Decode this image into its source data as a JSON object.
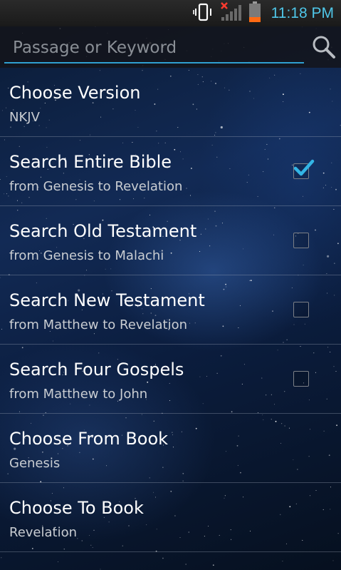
{
  "status_bar": {
    "time": "11:18 PM"
  },
  "search": {
    "placeholder": "Passage or Keyword",
    "value": ""
  },
  "items": [
    {
      "title": "Choose Version",
      "subtitle": "NKJV"
    },
    {
      "title": "Search Entire Bible",
      "subtitle": "from Genesis to Revelation",
      "checked": true
    },
    {
      "title": "Search Old Testament",
      "subtitle": "from Genesis to Malachi",
      "checked": false
    },
    {
      "title": "Search New Testament",
      "subtitle": "from Matthew to Revelation",
      "checked": false
    },
    {
      "title": "Search Four Gospels",
      "subtitle": "from Matthew to John",
      "checked": false
    },
    {
      "title": "Choose From Book",
      "subtitle": "Genesis"
    },
    {
      "title": "Choose To Book",
      "subtitle": "Revelation"
    }
  ],
  "colors": {
    "accent": "#4fc6e8",
    "underline": "#2f9fd0",
    "check": "#33b5e5"
  },
  "icons": [
    "phone-vibrate-icon",
    "no-signal-icon",
    "signal-bars-icon",
    "battery-icon",
    "search-icon",
    "checkmark-icon"
  ]
}
